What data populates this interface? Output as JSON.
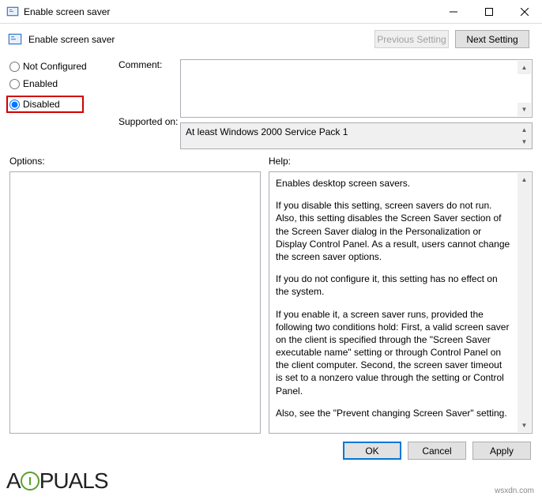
{
  "window": {
    "title": "Enable screen saver"
  },
  "header": {
    "subtitle": "Enable screen saver",
    "previous_setting": "Previous Setting",
    "next_setting": "Next Setting"
  },
  "radio": {
    "not_configured": "Not Configured",
    "enabled": "Enabled",
    "disabled": "Disabled",
    "selected": "disabled"
  },
  "labels": {
    "comment": "Comment:",
    "supported_on": "Supported on:",
    "options": "Options:",
    "help": "Help:"
  },
  "fields": {
    "comment": "",
    "supported_on": "At least Windows 2000 Service Pack 1"
  },
  "help": {
    "p1": "Enables desktop screen savers.",
    "p2": "If you disable this setting, screen savers do not run. Also, this setting disables the Screen Saver section of the Screen Saver dialog in the Personalization or Display Control Panel. As a result, users cannot change the screen saver options.",
    "p3": "If you do not configure it, this setting has no effect on the system.",
    "p4": "If you enable it, a screen saver runs, provided the following two conditions hold: First, a valid screen saver on the client is specified through the \"Screen Saver executable name\" setting or through Control Panel on the client computer. Second, the screen saver timeout is set to a nonzero value through the setting or Control Panel.",
    "p5": "Also, see the \"Prevent changing Screen Saver\" setting."
  },
  "buttons": {
    "ok": "OK",
    "cancel": "Cancel",
    "apply": "Apply"
  },
  "watermark": {
    "prefix": "A",
    "suffix": "PUALS"
  },
  "source": "wsxdn.com"
}
